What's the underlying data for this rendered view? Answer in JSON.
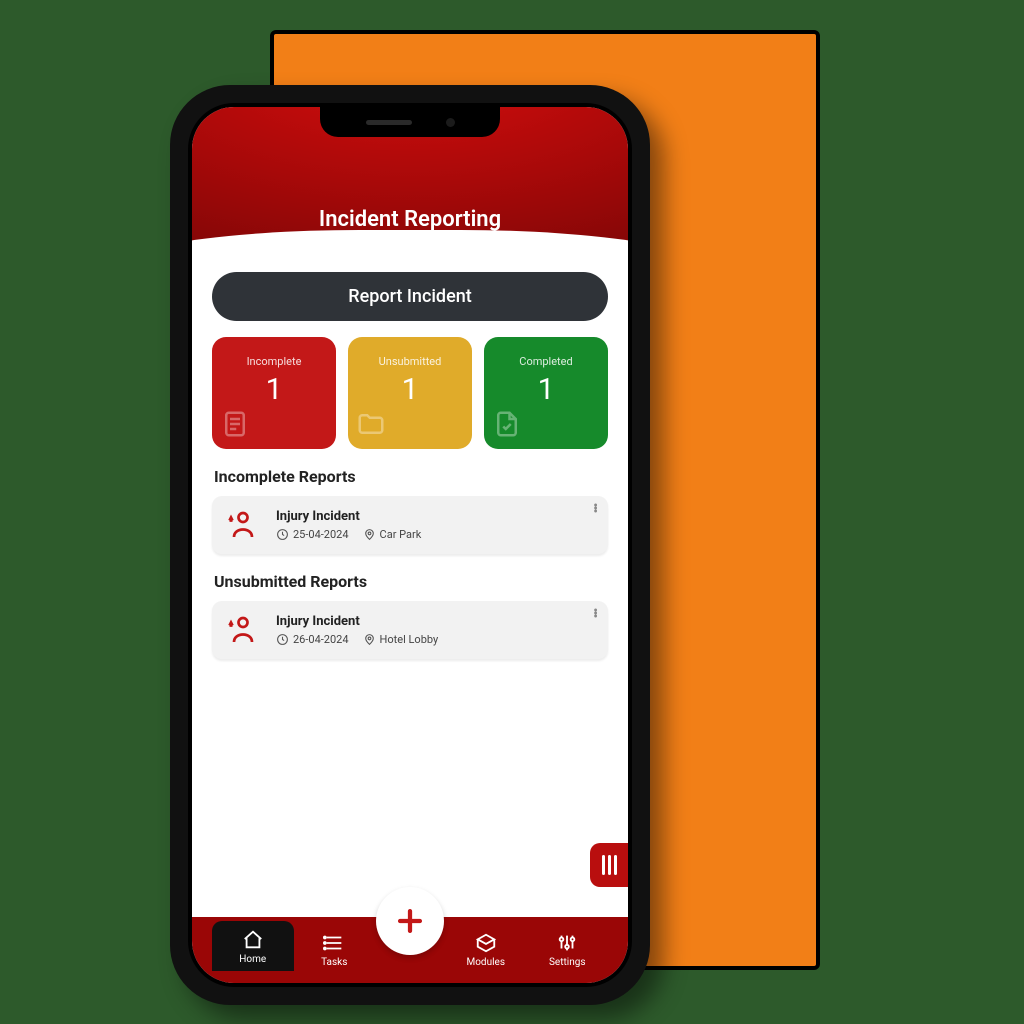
{
  "header": {
    "title": "Incident Reporting"
  },
  "report_button": "Report Incident",
  "tiles": [
    {
      "label": "Incomplete",
      "count": "1",
      "color": "red"
    },
    {
      "label": "Unsubmitted",
      "count": "1",
      "color": "amber"
    },
    {
      "label": "Completed",
      "count": "1",
      "color": "green"
    }
  ],
  "sections": {
    "incomplete": {
      "title": "Incomplete Reports"
    },
    "unsubmitted": {
      "title": "Unsubmitted Reports"
    }
  },
  "incomplete_reports": [
    {
      "title": "Injury Incident",
      "date": "25-04-2024",
      "location": "Car Park"
    }
  ],
  "unsubmitted_reports": [
    {
      "title": "Injury Incident",
      "date": "26-04-2024",
      "location": "Hotel Lobby"
    }
  ],
  "nav": {
    "home": "Home",
    "tasks": "Tasks",
    "modules": "Modules",
    "settings": "Settings"
  },
  "colors": {
    "red": "#c31818",
    "amber": "#e0ab2a",
    "green": "#168a2b",
    "brand": "#9a0606"
  }
}
